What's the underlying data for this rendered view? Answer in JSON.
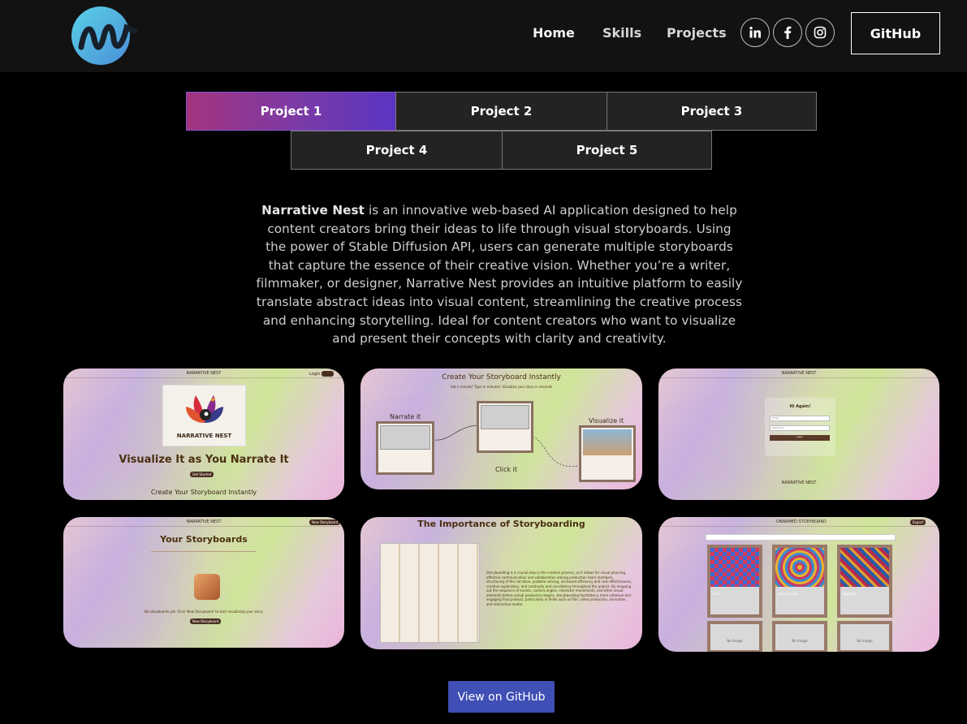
{
  "nav": {
    "home": "Home",
    "skills": "Skills",
    "projects": "Projects",
    "github": "GitHub",
    "socials": [
      "linkedin-icon",
      "facebook-icon",
      "instagram-icon"
    ]
  },
  "tabs": [
    "Project 1",
    "Project 2",
    "Project 3",
    "Project 4",
    "Project 5"
  ],
  "active_tab": "Project 1",
  "project": {
    "name": "Narrative Nest",
    "description": " is an innovative web-based AI application designed to help content creators bring their ideas to life through visual storyboards. Using the power of Stable Diffusion API, users can generate multiple storyboards that capture the essence of their creative vision. Whether you’re a writer, filmmaker, or designer, Narrative Nest provides an intuitive platform to easily translate abstract ideas into visual content, streamlining the creative process and enhancing storytelling. Ideal for content creators who want to visualize and present their concepts with clarity and creativity."
  },
  "screens": {
    "s1": {
      "brand": "NARRATIVE NEST",
      "logo_text": "NARRATIVE NEST",
      "headline": "Visualize It as You Narrate It",
      "button": "Get Started",
      "footer": "Create Your Storyboard Instantly",
      "login": "Login"
    },
    "s2": {
      "title": "Create Your Storyboard Instantly",
      "subtitle": "Got a minute? Type in minutes. Visualize your story in seconds",
      "narrate": "Narrate it",
      "click": "Click it",
      "visualize": "Visualize it"
    },
    "s3": {
      "brand": "NARRATIVE NEST",
      "greeting": "Hi Again!",
      "email": "Email",
      "password": "Password",
      "login": "Login",
      "footer_brand": "NARRATIVE NEST"
    },
    "s4": {
      "brand": "NARRATIVE NEST",
      "title": "Your Storyboards",
      "empty": "No storyboards yet. Click 'New Storyboard' to start visualizing your story.",
      "button": "New Storyboard",
      "top_button": "New Storyboard"
    },
    "s5": {
      "title": "The Importance of Storyboarding",
      "body": "Storyboarding is a crucial step in the creative process, as it allows for visual planning, effective communication and collaboration among production team members, structuring of the narrative, problem-solving, increased efficiency and cost-effectiveness, creative exploration, and continuity and consistency throughout the project. By mapping out the sequence of events, camera angles, character movements, and other visual elements before actual production begins, storyboarding facilitates a more cohesive and engaging final product, particularly in fields such as film, video production, animation, and interactive media."
    },
    "s6": {
      "title": "UNNAMED STORYBOARD",
      "export": "Export",
      "captions": [
        "Cells",
        "Doors to the...",
        "Highway"
      ],
      "no_image": [
        "No Image",
        "No Image",
        "No Image"
      ]
    }
  },
  "cta": "View on GitHub",
  "colors": {
    "nav_bg": "#121212",
    "tab_active_start": "#a3347f",
    "tab_active_end": "#5a35c2",
    "cta": "#3f4fb5"
  }
}
